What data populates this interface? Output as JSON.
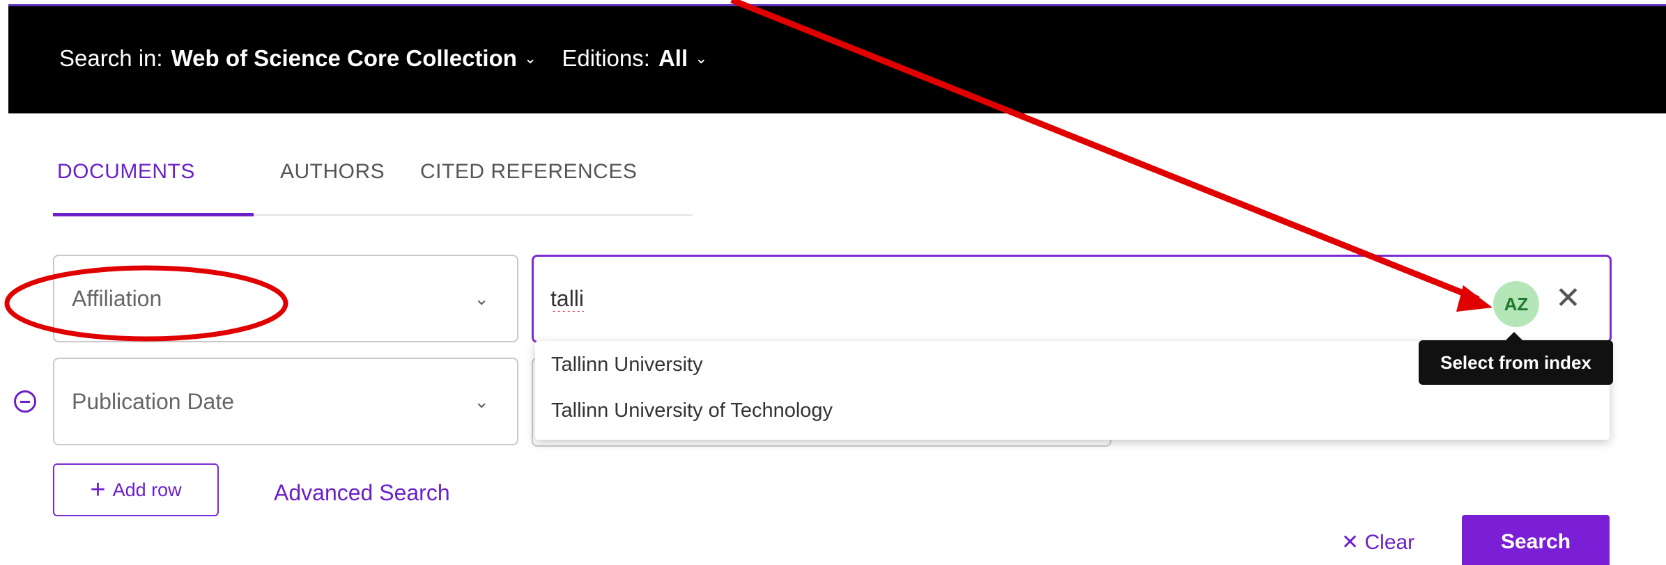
{
  "top_bar": {
    "search_in_label": "Search in:",
    "collection": "Web of Science Core Collection",
    "editions_label": "Editions:",
    "editions_value": "All"
  },
  "tabs": [
    {
      "label": "DOCUMENTS",
      "active": true
    },
    {
      "label": "AUTHORS",
      "active": false
    },
    {
      "label": "CITED REFERENCES",
      "active": false
    }
  ],
  "rows": [
    {
      "field": "Affiliation",
      "value": "talli"
    },
    {
      "field": "Publication Date",
      "value": ""
    }
  ],
  "suggestions": [
    "Tallinn University",
    "Tallinn University of Technology"
  ],
  "az_button_label": "AZ",
  "tooltip": "Select from index",
  "add_row_label": "Add row",
  "advanced_search_label": "Advanced Search",
  "clear_label": "Clear",
  "search_button_label": "Search",
  "colors": {
    "accent": "#6b20c9",
    "annotation": "#e00000",
    "az_bg": "#b5e6b8"
  }
}
